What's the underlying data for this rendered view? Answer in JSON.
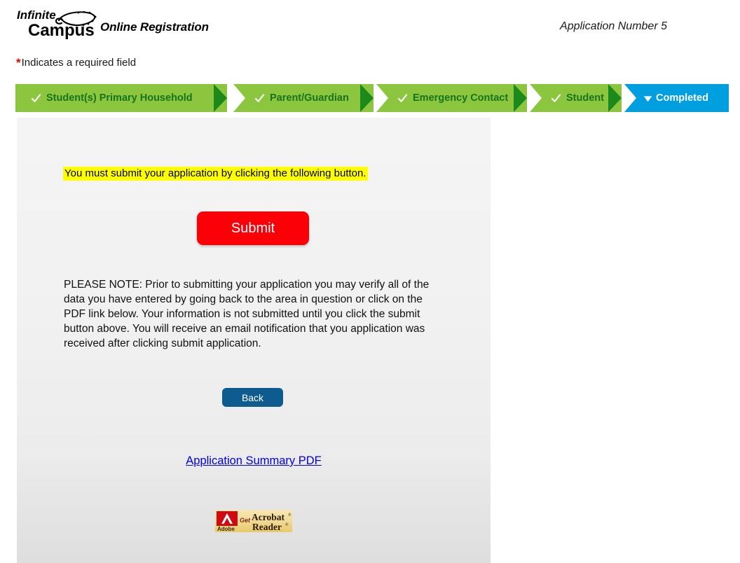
{
  "header": {
    "logo_line1": "Infinite",
    "logo_line2": "Campus",
    "logo_icon": "campus-swoosh-icon",
    "app_title": "Online Registration",
    "application_number": "Application Number 5"
  },
  "required_note": {
    "asterisk": "*",
    "text": "Indicates a required field",
    "asterisk_color": "#ee0000"
  },
  "progress": {
    "done_color": "#8cc63e",
    "done_arrow_color": "#1b8a1b",
    "done_text_color": "#17741d",
    "current_color": "#009fdf",
    "current_text_color": "#ffffff",
    "steps": [
      {
        "label": "Student(s) Primary Household",
        "state": "done",
        "icon": "check-icon"
      },
      {
        "label": "Parent/Guardian",
        "state": "done",
        "icon": "check-icon"
      },
      {
        "label": "Emergency Contact",
        "state": "done",
        "icon": "check-icon"
      },
      {
        "label": "Student",
        "state": "done",
        "icon": "check-icon"
      },
      {
        "label": "Completed",
        "state": "current",
        "icon": "triangle-down-icon"
      }
    ]
  },
  "main": {
    "alert": "You must submit your application by clicking the following button.",
    "alert_bg": "#ffff00",
    "submit_label": "Submit",
    "submit_color": "#fb0007",
    "please_note": "PLEASE NOTE: Prior to submitting your application you may verify all of the data you have entered by going back to the area in question or click on the PDF link below. Your information is not submitted until you click the submit button above. You will receive an email notification that you application was received after clicking submit application.",
    "back_label": "Back",
    "back_color": "#0d5b8f",
    "pdf_link_label": "Application Summary PDF",
    "pdf_link_color": "#0000ee",
    "acrobat_badge": {
      "name": "get-acrobat-reader-badge",
      "get": "Get",
      "adobe": "Adobe",
      "line1": "Acrobat",
      "line2": "Reader",
      "registered": "®"
    }
  }
}
